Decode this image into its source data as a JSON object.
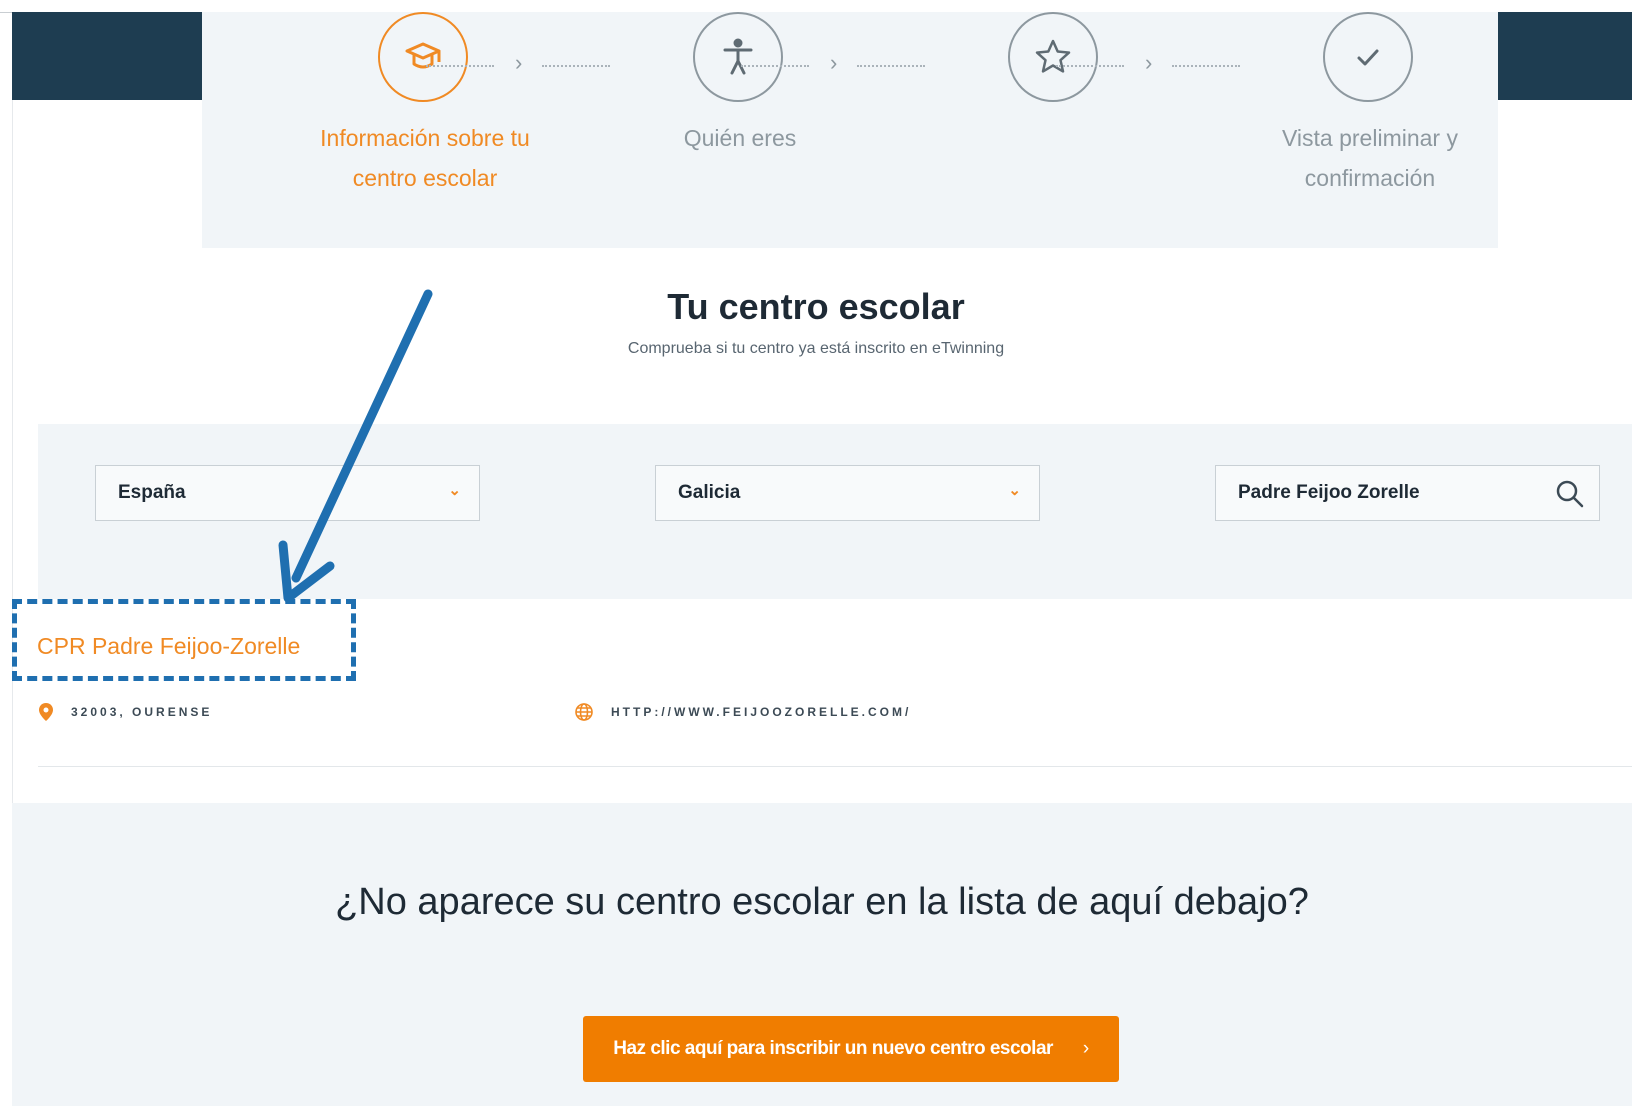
{
  "stepper": {
    "steps": [
      {
        "label_line1": "Información sobre tu",
        "label_line2": "centro escolar",
        "icon": "graduation-cap-icon",
        "active": true
      },
      {
        "label_line1": "Quién eres",
        "label_line2": "",
        "icon": "person-icon",
        "active": false
      },
      {
        "label_line1": "",
        "label_line2": "",
        "icon": "star-icon",
        "active": false
      },
      {
        "label_line1": "Vista preliminar y",
        "label_line2": "confirmación",
        "icon": "check-icon",
        "active": false
      }
    ]
  },
  "section": {
    "title": "Tu centro escolar",
    "subtitle": "Comprueba si tu centro ya está inscrito en eTwinning"
  },
  "filters": {
    "country": "España",
    "region": "Galicia",
    "search_value": "Padre Feijoo Zorelle"
  },
  "result": {
    "name": "CPR Padre Feijoo-Zorelle",
    "location": "32003, OURENSE",
    "website": "HTTP://WWW.FEIJOOZORELLE.COM/"
  },
  "not_listed": {
    "question": "¿No aparece su centro escolar en la lista de aquí debajo?",
    "button_label": "Haz clic aquí para inscribir un nuevo centro escolar",
    "button_chevron": "›"
  },
  "colors": {
    "accent": "#f08a24",
    "header": "#1e3d51",
    "annotation": "#1f6fb0"
  }
}
